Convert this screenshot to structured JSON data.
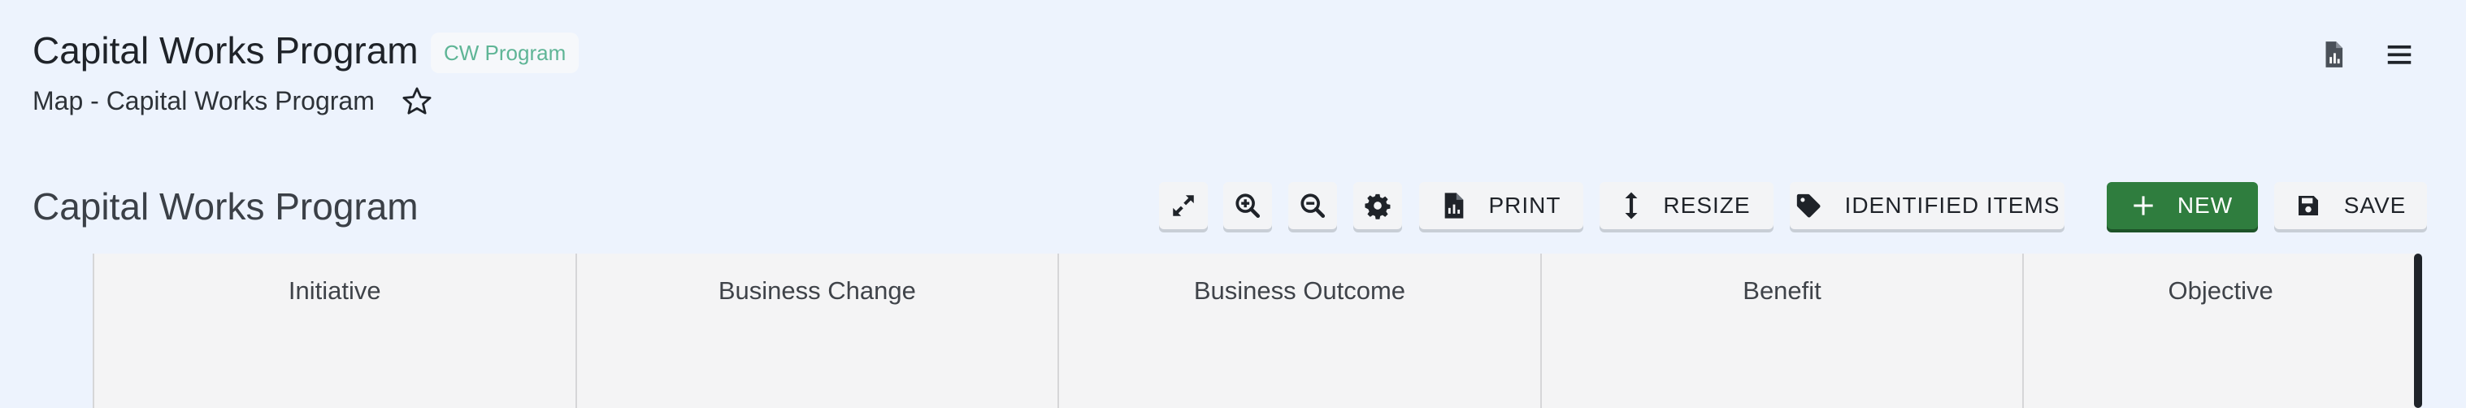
{
  "header": {
    "title": "Capital Works Program",
    "tag": "CW Program",
    "subtitle": "Map - Capital Works Program",
    "icons": [
      "star-icon",
      "document-chart-icon",
      "hamburger-menu-icon"
    ]
  },
  "section": {
    "title": "Capital Works Program"
  },
  "toolbar": {
    "expand_icon": "expand-icon",
    "zoom_in_icon": "zoom-in-icon",
    "zoom_out_icon": "zoom-out-icon",
    "settings_icon": "gear-icon",
    "print_label": "PRINT",
    "resize_label": "RESIZE",
    "identified_label": "IDENTIFIED ITEMS",
    "new_label": "NEW",
    "save_label": "SAVE"
  },
  "grid": {
    "columns": [
      "Initiative",
      "Business Change",
      "Business Outcome",
      "Benefit",
      "Objective"
    ]
  },
  "colors": {
    "background": "#edf3fd",
    "accent_green": "#2f7d3e",
    "tag_text": "#5fb596",
    "grid_bg": "#f4f4f5"
  }
}
